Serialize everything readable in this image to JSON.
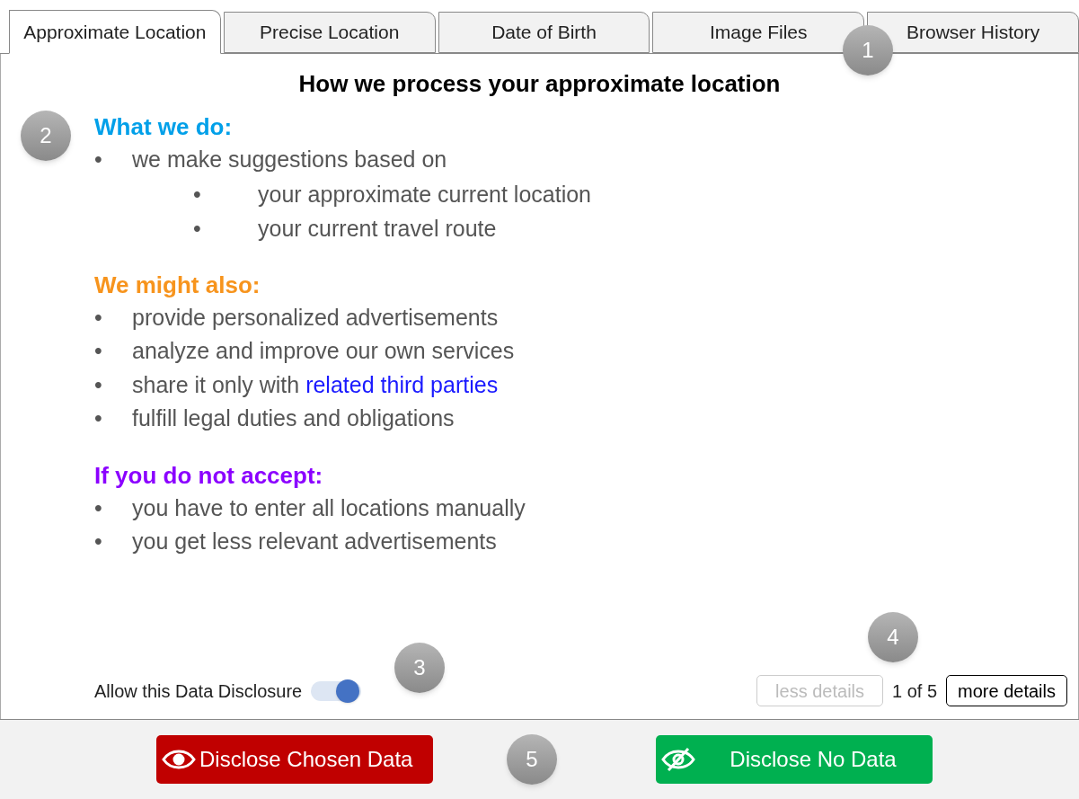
{
  "tabs": [
    {
      "label": "Approximate Location",
      "selected": true
    },
    {
      "label": "Precise Location",
      "selected": false
    },
    {
      "label": "Date of Birth",
      "selected": false
    },
    {
      "label": "Image Files",
      "selected": false
    },
    {
      "label": "Browser History",
      "selected": false
    }
  ],
  "title": "How we process your approximate location",
  "sections": [
    {
      "heading": "What we do:",
      "color": "#00a0e9",
      "items": [
        {
          "text": "we make suggestions based on",
          "children": [
            {
              "text": "your approximate current location"
            },
            {
              "text": "your current travel route"
            }
          ]
        }
      ]
    },
    {
      "heading": "We might also:",
      "color": "#f7941d",
      "items": [
        {
          "text": "provide personalized advertisements"
        },
        {
          "text": "analyze and improve our own services"
        },
        {
          "text": "share it only with ",
          "link": "related third parties"
        },
        {
          "text": "fulfill legal duties and obligations"
        }
      ]
    },
    {
      "heading": "If you do not accept:",
      "color": "#8b00ff",
      "items": [
        {
          "text": "you have to enter all locations manually"
        },
        {
          "text": "you get less relevant advertisements"
        }
      ]
    }
  ],
  "bullet": "•",
  "toggle": {
    "label": "Allow this Data Disclosure",
    "on": true
  },
  "pager": {
    "less": {
      "label": "less details",
      "disabled": true
    },
    "count": "1 of 5",
    "more": {
      "label": "more details",
      "disabled": false
    }
  },
  "actions": [
    {
      "label": "Disclose Chosen Data",
      "kind": "disclose"
    },
    {
      "label": "Disclose No Data",
      "kind": "none"
    }
  ],
  "markers": [
    "1",
    "2",
    "3",
    "4",
    "5"
  ]
}
